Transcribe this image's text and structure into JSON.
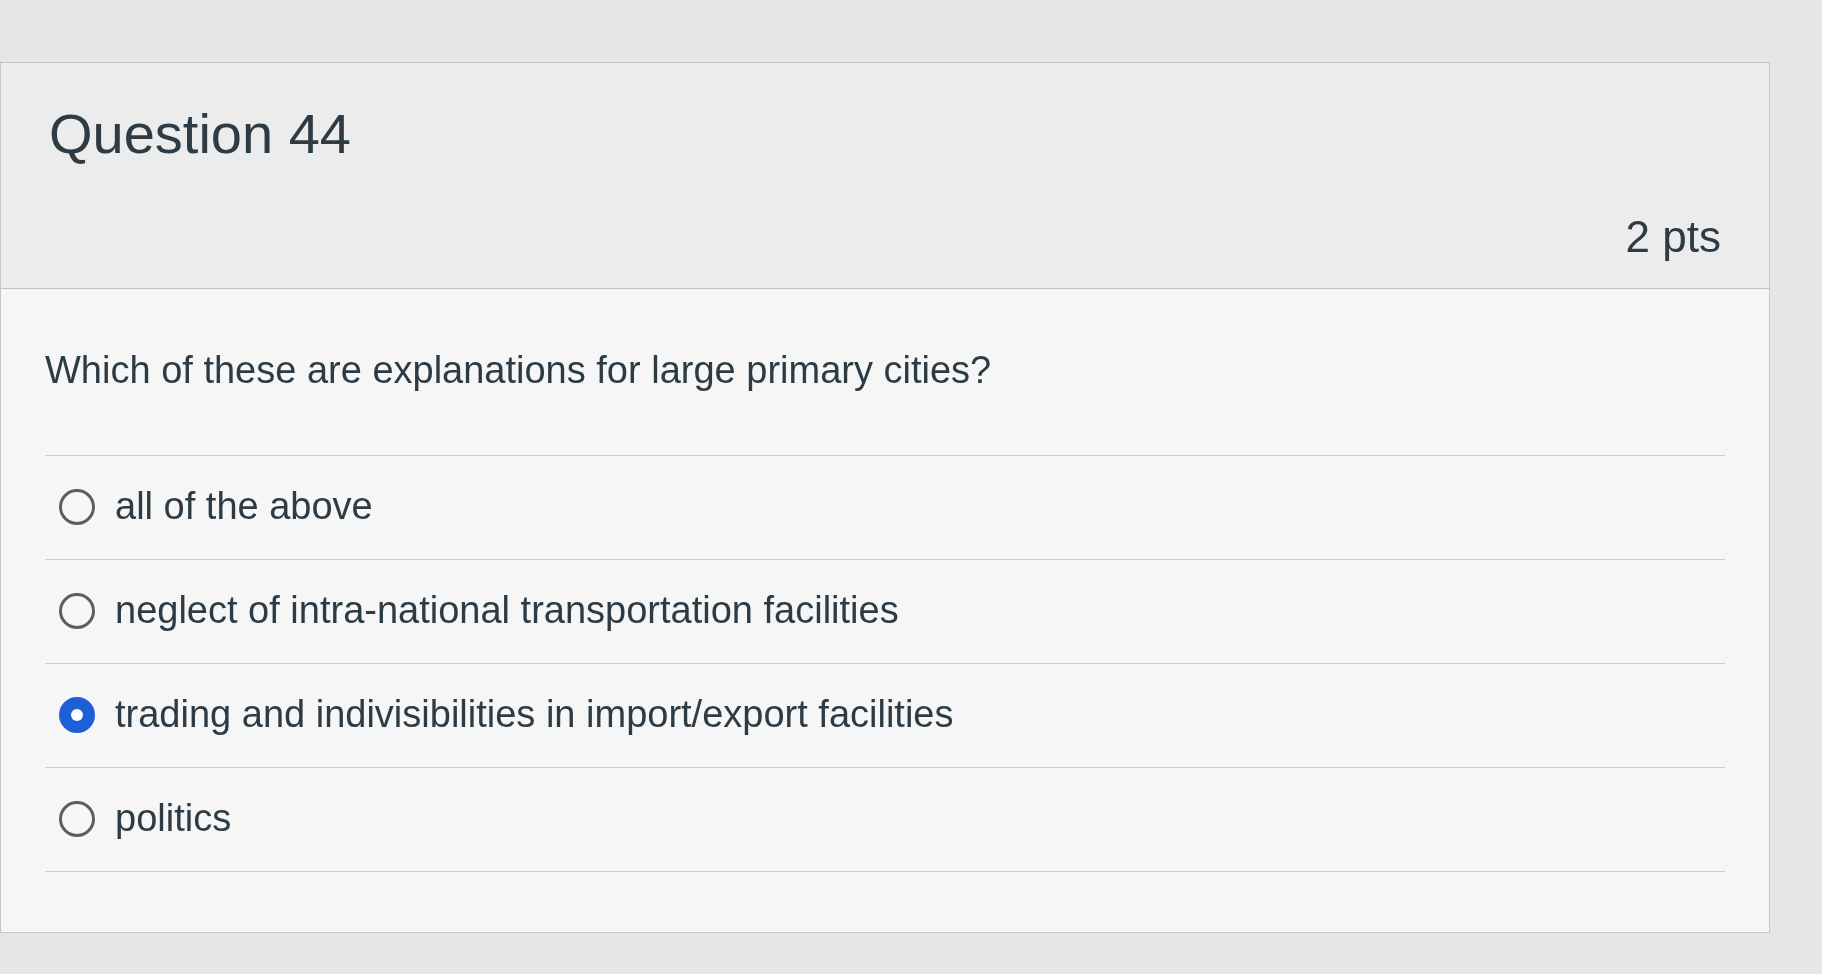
{
  "question": {
    "title": "Question 44",
    "points": "2 pts",
    "text": "Which of these are explanations for large primary cities?",
    "options": [
      {
        "label": "all of the above",
        "selected": false
      },
      {
        "label": "neglect of intra-national transportation facilities",
        "selected": false
      },
      {
        "label": "trading and indivisibilities in import/export facilities",
        "selected": true
      },
      {
        "label": "politics",
        "selected": false
      }
    ]
  }
}
